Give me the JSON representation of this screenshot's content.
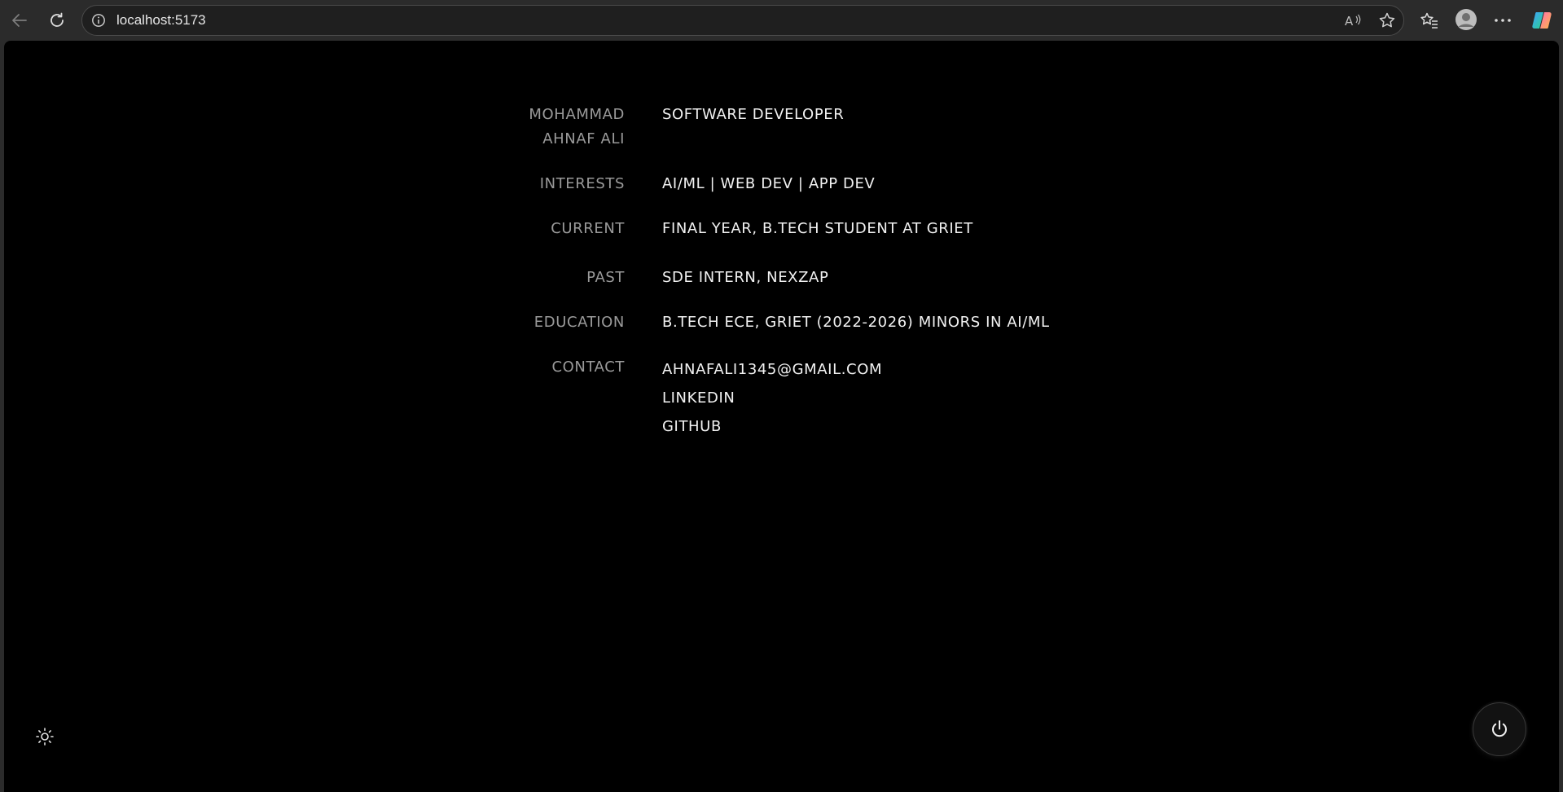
{
  "browser": {
    "url": "localhost:5173"
  },
  "profile": {
    "name_line1": "MOHAMMAD",
    "name_line2": "AHNAF ALI",
    "role": "SOFTWARE DEVELOPER",
    "interests_label": "INTERESTS",
    "interests_value": "AI/ML | WEB DEV | APP DEV",
    "current_label": "CURRENT",
    "current_value": "FINAL YEAR, B.TECH STUDENT AT GRIET",
    "past_label": "PAST",
    "past_value": "SDE INTERN, NEXZAP",
    "education_label": "EDUCATION",
    "education_value": "B.TECH ECE, GRIET (2022-2026) MINORS IN AI/ML",
    "contact_label": "CONTACT",
    "contact_email": "AHNAFALI1345@GMAIL.COM",
    "contact_linkedin": "LINKEDIN",
    "contact_github": "GITHUB"
  },
  "icons": {
    "back": "back-arrow-icon",
    "refresh": "refresh-icon",
    "site_info": "info-icon",
    "read_aloud": "read-aloud-icon",
    "favorite": "star-icon",
    "favorites": "favorites-icon",
    "profile": "profile-icon",
    "more": "more-icon",
    "copilot": "copilot-icon",
    "theme": "sun-icon",
    "power": "power-icon"
  }
}
